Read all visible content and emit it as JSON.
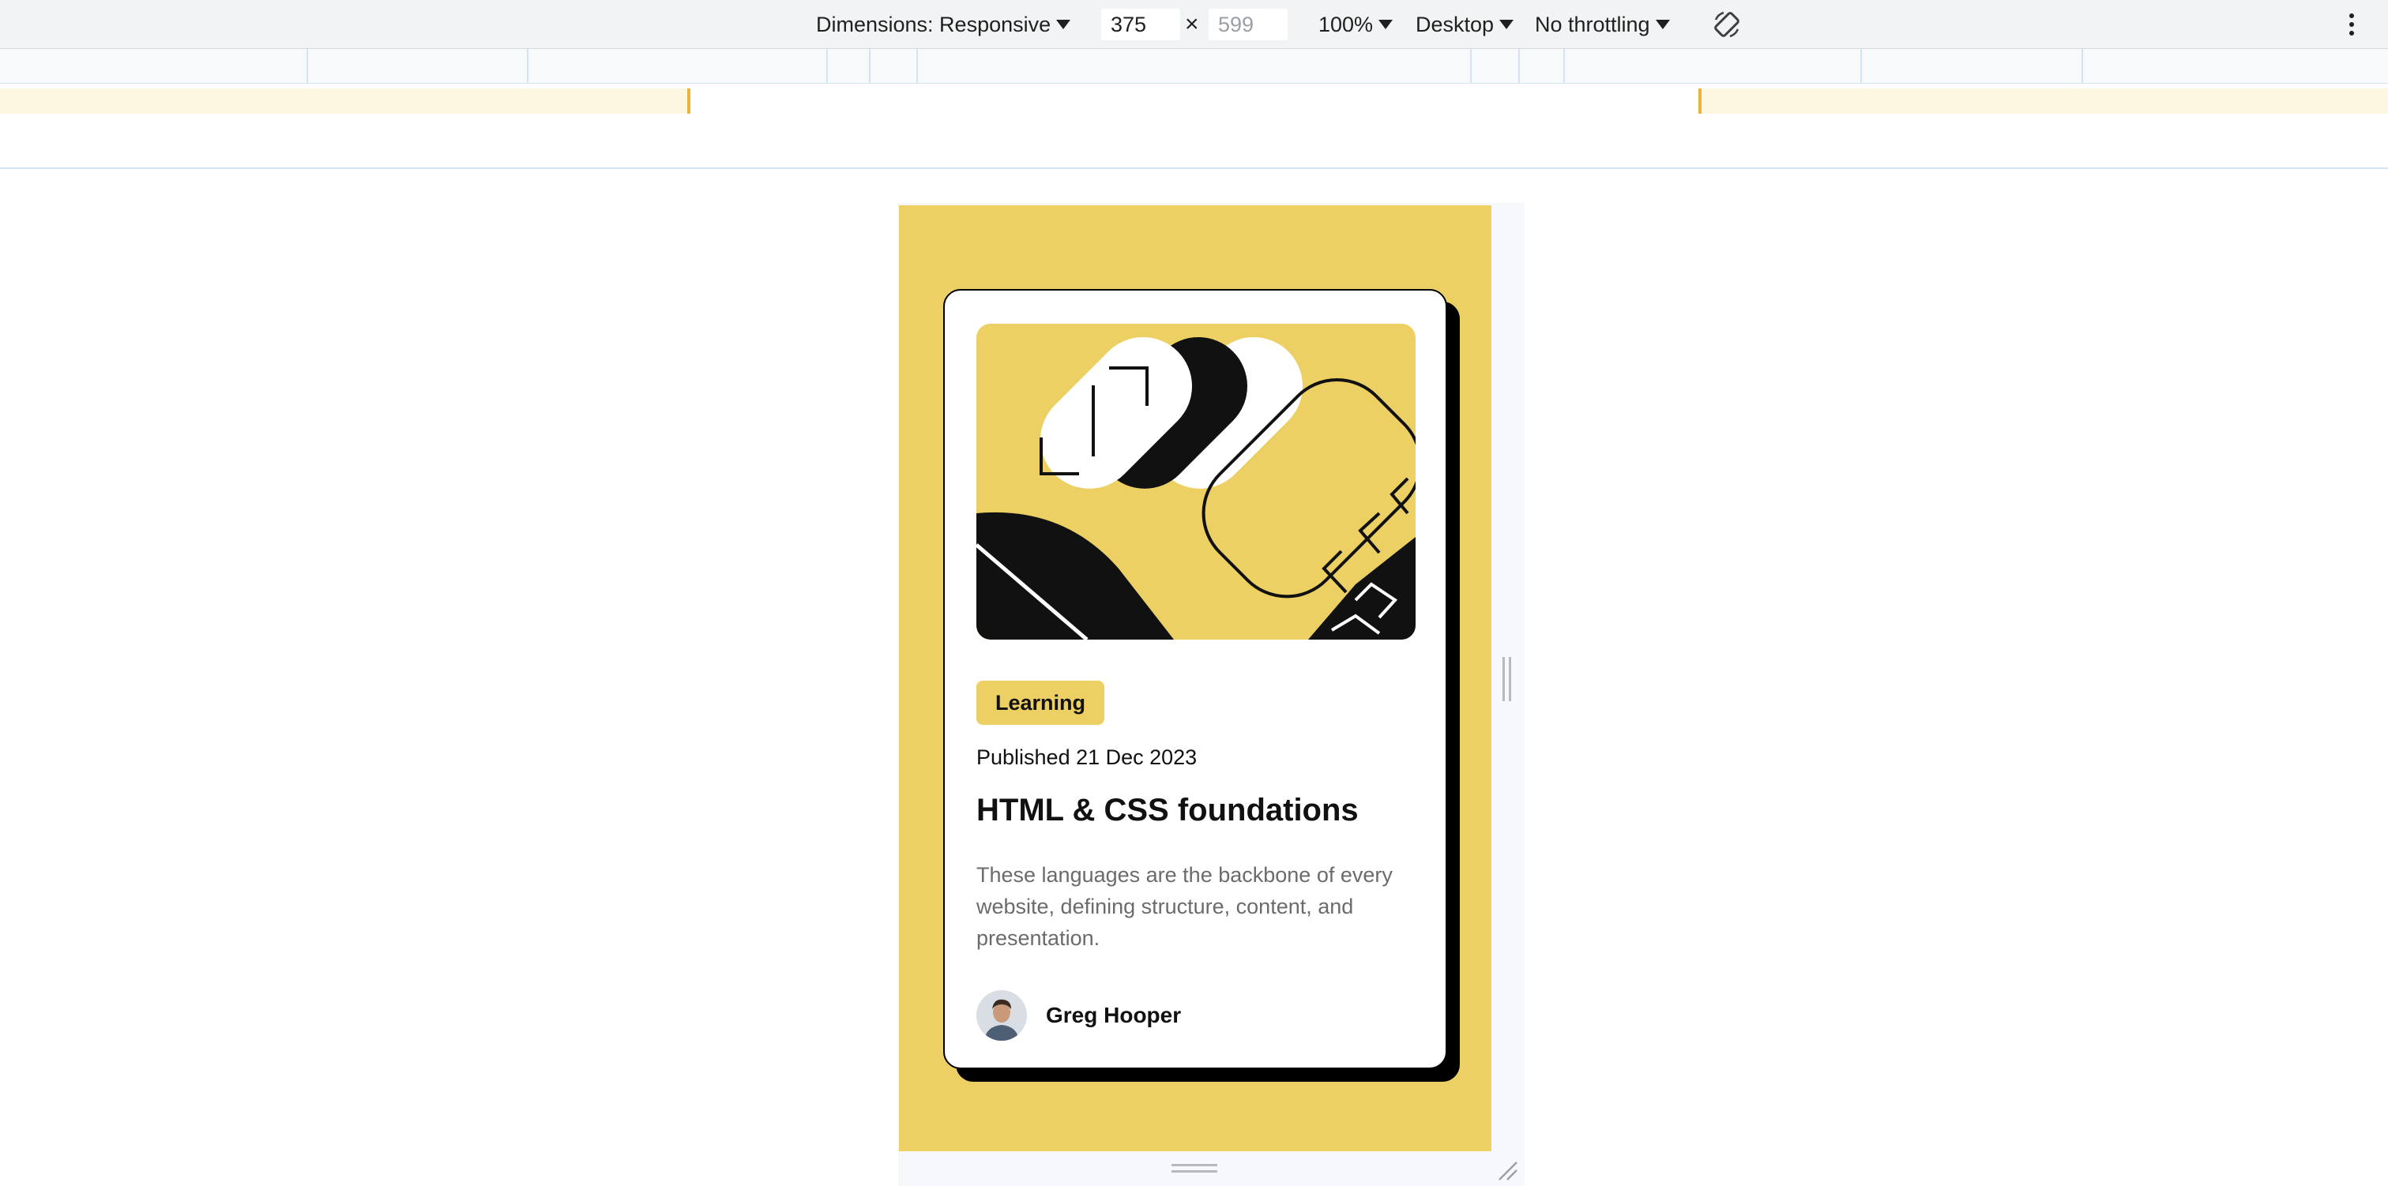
{
  "toolbar": {
    "dimensions_label": "Dimensions: Responsive",
    "width_value": "375",
    "height_placeholder": "599",
    "times_symbol": "×",
    "zoom_label": "100%",
    "device_type_label": "Desktop",
    "throttling_label": "No throttling",
    "icons": [
      "caret-down-icon",
      "rotate-icon",
      "more-vert-icon"
    ]
  },
  "card": {
    "tag_label": "Learning",
    "published": "Published 21 Dec 2023",
    "title": "HTML & CSS foundations",
    "description": "These languages are the backbone of every website, defining structure, content, and presentation.",
    "author_name": "Greg Hooper"
  },
  "colors": {
    "accent_yellow": "#ecd064",
    "card_border": "#000000",
    "text_muted": "#6b6b6b",
    "toolbar_bg": "#f1f3f4"
  }
}
